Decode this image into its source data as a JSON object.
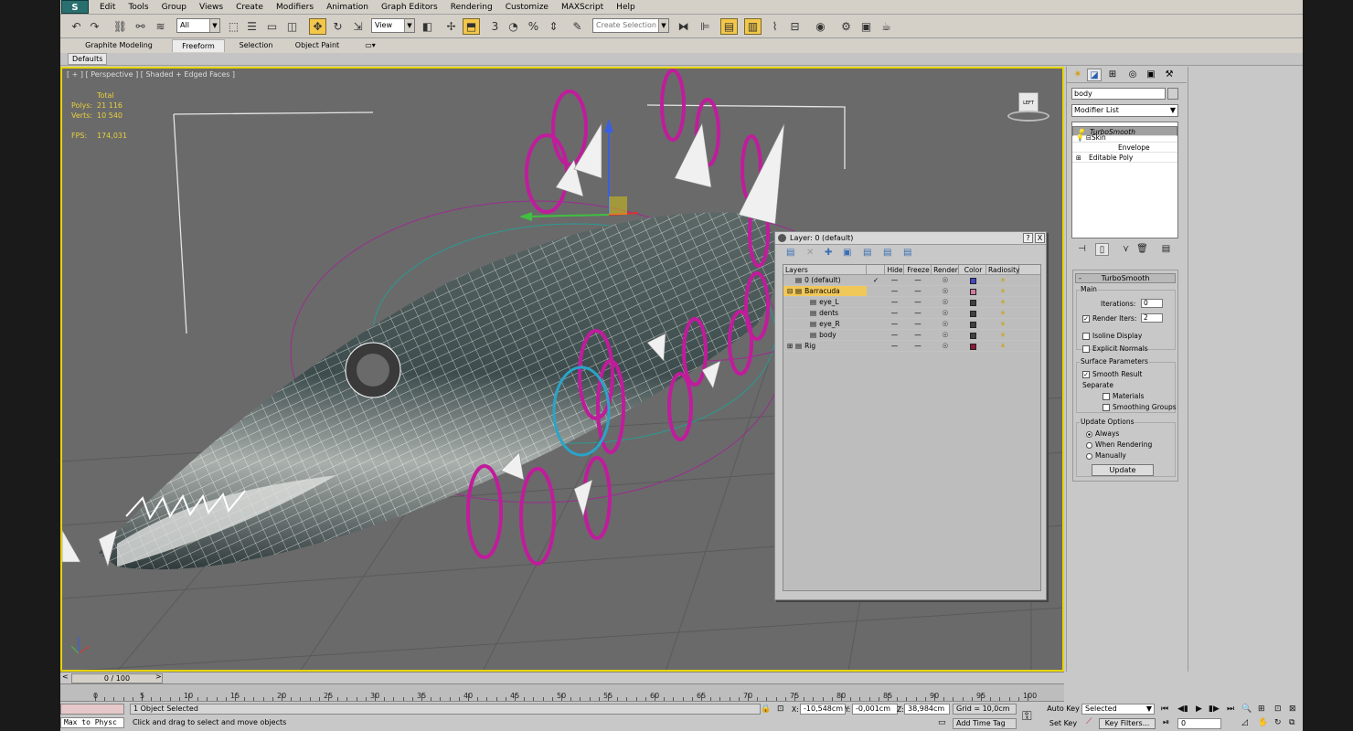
{
  "app": {
    "logo": "S"
  },
  "menu": [
    "Edit",
    "Tools",
    "Group",
    "Views",
    "Create",
    "Modifiers",
    "Animation",
    "Graph Editors",
    "Rendering",
    "Customize",
    "MAXScript",
    "Help"
  ],
  "toolbar": {
    "selection_filter": "All",
    "ref_coord": "View",
    "snap_label": "3",
    "named_selection_placeholder": "Create Selection Se"
  },
  "ribbon": {
    "tabs": [
      "Graphite Modeling Tools",
      "Freeform",
      "Selection",
      "Object Paint"
    ],
    "active_tab": "Freeform",
    "panel": "Defaults"
  },
  "viewport": {
    "label": "[ + ] [ Perspective ] [ Shaded + Edged Faces ]",
    "stats": {
      "header": "Total",
      "polys_label": "Polys:",
      "polys_value": "21 116",
      "verts_label": "Verts:",
      "verts_value": "10 540",
      "fps_label": "FPS:",
      "fps_value": "174,031"
    },
    "viewcube_label": "LEFT"
  },
  "layer_dialog": {
    "title": "Layer: 0 (default)",
    "help": "?",
    "close": "X",
    "columns": [
      "Layers",
      "Hide",
      "Freeze",
      "Render",
      "Color",
      "Radiosity"
    ],
    "rows": [
      {
        "name": "0 (default)",
        "level": 0,
        "check": "✓",
        "expand": "",
        "color": "#4646c8",
        "highlight": false
      },
      {
        "name": "Barracuda",
        "level": 0,
        "check": "",
        "expand": "⊟",
        "color": "#d47aa0",
        "highlight": true
      },
      {
        "name": "eye_L",
        "level": 1,
        "check": "",
        "expand": "",
        "color": "#404040",
        "highlight": false
      },
      {
        "name": "dents",
        "level": 1,
        "check": "",
        "expand": "",
        "color": "#404040",
        "highlight": false
      },
      {
        "name": "eye_R",
        "level": 1,
        "check": "",
        "expand": "",
        "color": "#404040",
        "highlight": false
      },
      {
        "name": "body",
        "level": 1,
        "check": "",
        "expand": "",
        "color": "#404040",
        "highlight": false
      },
      {
        "name": "Rig",
        "level": 0,
        "check": "",
        "expand": "⊞",
        "color": "#8a1a3a",
        "highlight": false
      }
    ],
    "hide_mark": "—",
    "freeze_mark": "—",
    "render_mark": "☉",
    "radiosity_mark": "☀"
  },
  "command_panel": {
    "object_name": "body",
    "modifier_list": "Modifier List",
    "stack": [
      {
        "label": "TurboSmooth",
        "indent": 0,
        "prefix": "💡",
        "selected": true
      },
      {
        "label": "Skin",
        "indent": 0,
        "prefix": "💡 ⊟",
        "selected": false
      },
      {
        "label": "Envelope",
        "indent": 2,
        "prefix": "",
        "selected": false
      },
      {
        "label": "Editable Poly",
        "indent": 0,
        "prefix": "⊞",
        "selected": false
      }
    ],
    "rollout_title": "TurboSmooth",
    "rollout_collapse": "-",
    "main_group": "Main",
    "iterations_label": "Iterations:",
    "iterations_value": "0",
    "render_iters_label": "Render Iters:",
    "render_iters_value": "2",
    "isoline_label": "Isoline Display",
    "explicit_normals_label": "Explicit Normals",
    "surface_group": "Surface Parameters",
    "smooth_result_label": "Smooth Result",
    "separate_label": "Separate",
    "materials_label": "Materials",
    "smoothing_groups_label": "Smoothing Groups",
    "update_group": "Update Options",
    "always_label": "Always",
    "when_rendering_label": "When Rendering",
    "manually_label": "Manually",
    "update_button": "Update"
  },
  "timeline": {
    "frame_display": "0 / 100",
    "ticks": [
      0,
      5,
      10,
      15,
      20,
      25,
      30,
      35,
      40,
      45,
      50,
      55,
      60,
      65,
      70,
      75,
      80,
      85,
      90,
      95,
      100
    ]
  },
  "status": {
    "maxscript": "Max to Physc",
    "selection": "1 Object Selected",
    "prompt": "Click and drag to select and move objects",
    "x_label": "X:",
    "x_value": "-10,548cm",
    "y_label": "Y:",
    "y_value": "-0,001cm",
    "z_label": "Z:",
    "z_value": "38,984cm",
    "grid": "Grid = 10,0cm",
    "add_time_tag": "Add Time Tag",
    "auto_key": "Auto Key",
    "set_key": "Set Key",
    "key_mode": "Selected",
    "key_filters": "Key Filters...",
    "current_frame": "0"
  }
}
